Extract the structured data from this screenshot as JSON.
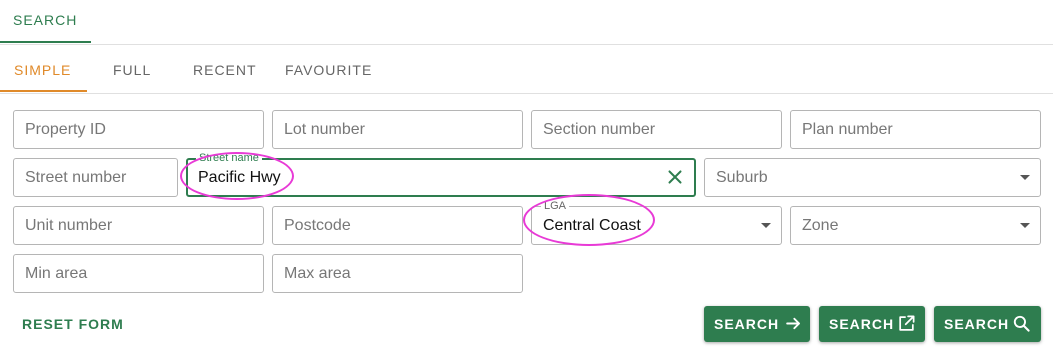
{
  "top_tab": {
    "label": "SEARCH"
  },
  "sub_tabs": [
    {
      "label": "SIMPLE",
      "active": true
    },
    {
      "label": "FULL",
      "active": false
    },
    {
      "label": "RECENT",
      "active": false
    },
    {
      "label": "FAVOURITE",
      "active": false
    }
  ],
  "form": {
    "property_id": {
      "placeholder": "Property ID"
    },
    "lot_number": {
      "placeholder": "Lot number"
    },
    "section_number": {
      "placeholder": "Section number"
    },
    "plan_number": {
      "placeholder": "Plan number"
    },
    "street_number": {
      "placeholder": "Street number"
    },
    "street_name": {
      "label": "Street name",
      "value": "Pacific Hwy"
    },
    "suburb": {
      "placeholder": "Suburb"
    },
    "unit_number": {
      "placeholder": "Unit number"
    },
    "postcode": {
      "placeholder": "Postcode"
    },
    "lga": {
      "label": "LGA",
      "value": "Central Coast"
    },
    "zone": {
      "placeholder": "Zone"
    },
    "min_area": {
      "placeholder": "Min area"
    },
    "max_area": {
      "placeholder": "Max area"
    }
  },
  "actions": {
    "reset_label": "RESET FORM",
    "search_label": "SEARCH",
    "search_new_tab_label": "SEARCH",
    "search_zoom_label": "SEARCH"
  },
  "icons": {
    "search_arrow": "arrow-right-icon",
    "search_new_tab": "open-in-new-icon",
    "search_zoom": "magnifier-icon",
    "clear": "close-icon",
    "dropdown": "chevron-down-icon"
  },
  "colors": {
    "primary": "#2e7d4f",
    "accent": "#e08a2a",
    "annotation": "#e83ad6"
  }
}
